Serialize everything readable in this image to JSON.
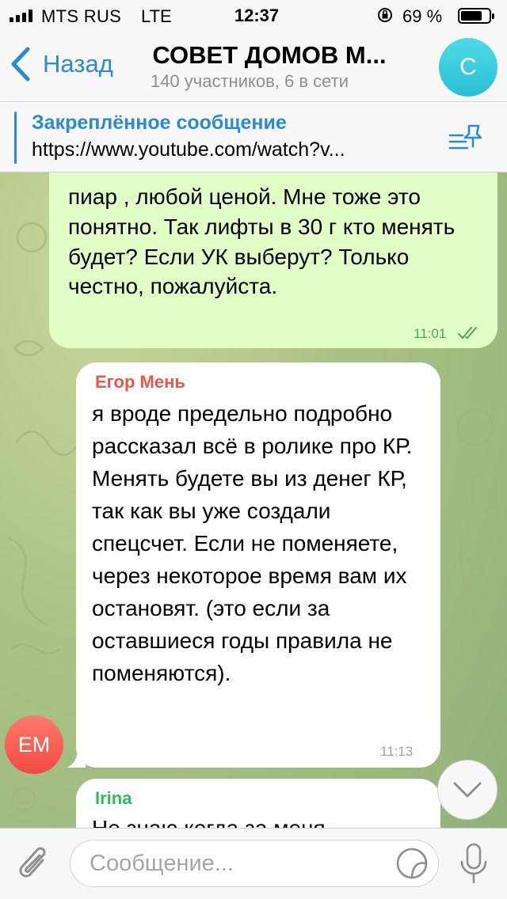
{
  "status_bar": {
    "carrier": "MTS RUS",
    "network": "LTE",
    "time": "12:37",
    "battery_percent": "69 %"
  },
  "header": {
    "back_label": "Назад",
    "title": "СОВЕТ ДОМОВ М...",
    "subtitle": "140 участников, 6 в сети",
    "avatar_letter": "С"
  },
  "pinned": {
    "title": "Закреплённое сообщение",
    "text": "https://www.youtube.com/watch?v..."
  },
  "messages": [
    {
      "direction": "outgoing",
      "text": "пиар , любой ценой. Мне тоже это понятно. Так лифты в 30 г кто менять будет? Если УК выберут? Только честно, пожалуйста.",
      "time": "11:01",
      "status": "read"
    },
    {
      "direction": "incoming",
      "sender": "Егор Мень",
      "sender_color": "#e8584a",
      "avatar_initials": "ЕМ",
      "text": "я вроде предельно подробно рассказал всё в ролике про КР. Менять будете вы из денег КР, так как вы уже создали спецсчет. Если не поменяете, через некоторое время вам их остановят. (это если за оставшиеся годы правила не поменяются).",
      "time": "11:13"
    },
    {
      "direction": "incoming",
      "sender": "Irina",
      "sender_color": "#2bbd57",
      "text": "Не знаю когда за меня"
    }
  ],
  "input": {
    "placeholder": "Сообщение..."
  },
  "colors": {
    "accent": "#2b8ad8",
    "outgoing_bubble": "#e1fec6",
    "outgoing_time": "#4fa55b"
  }
}
